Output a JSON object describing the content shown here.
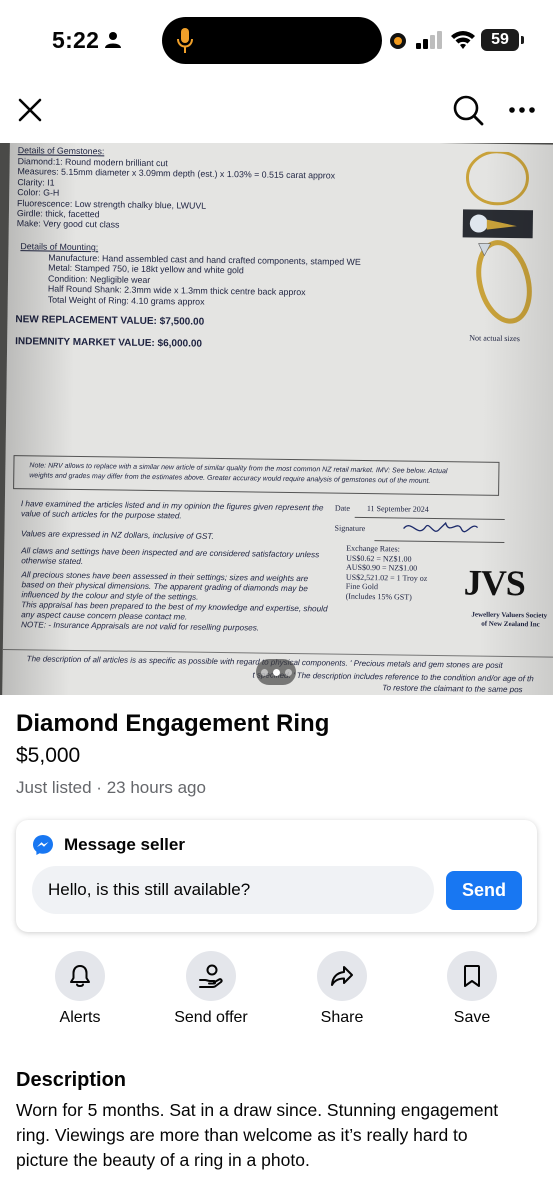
{
  "status_bar": {
    "time": "5:22",
    "battery": "59"
  },
  "photo": {
    "current_index": 2,
    "total": 3,
    "document": {
      "gem_heading": "Details of Gemstones:",
      "gem_lines": [
        "Diamond:1: Round modern brilliant cut",
        "Measures: 5.15mm diameter x 3.09mm depth (est.) x 1.03% = 0.515 carat approx",
        "Clarity: I1",
        "Color: G-H",
        "Fluorescence: Low strength chalky blue, LWUVL",
        "Girdle: thick, facetted",
        "Make: Very good cut class"
      ],
      "mount_heading": "Details of Mounting:",
      "mount_lines": [
        "Manufacture: Hand assembled cast and hand crafted components, stamped WE",
        "Metal: Stamped 750, ie 18kt yellow and white gold",
        "Condition: Negligible wear",
        "Half Round Shank: 2.3mm wide x 1.3mm thick centre back approx",
        "Total Weight of Ring: 4.10 grams approx"
      ],
      "replacement_value": "NEW REPLACEMENT VALUE: $7,500.00",
      "indemnity_value": "INDEMNITY MARKET VALUE: $6,000.00",
      "not_actual": "Not actual sizes",
      "note_lines": [
        "Note: NRV allows to replace with a similar new article of similar quality from the most common NZ retail market. IMV: See below. Actual",
        "weights and grades may differ from the estimates above. Greater accuracy would require analysis of gemstones out of the mount."
      ],
      "date_label": "Date",
      "date_value": "11 September 2024",
      "signature_label": "Signature",
      "exchange_lines": [
        "Exchange Rates:",
        "US$0.62 = NZ$1.00",
        "AUS$0.90 = NZ$1.00",
        "US$2,521.02 = 1 Troy oz",
        "Fine Gold",
        "(Includes 15% GST)"
      ],
      "left_statements": [
        "I have examined the articles listed and in my opinion the figures given represent the",
        "value of such articles for the purpose stated.",
        "Values are expressed in NZ dollars, inclusive of GST.",
        "All claws and settings have been inspected and are considered satisfactory unless",
        "otherwise stated.",
        "All precious stones have been assessed in their settings; sizes and weights are",
        "based on their physical dimensions. The apparent grading of diamonds may be",
        "influenced by the colour and style of the settings.",
        "This appraisal has been prepared to the best of my knowledge and expertise, should",
        "any aspect cause concern please contact me.",
        "NOTE: - Insurance Appraisals are not valid for reselling purposes."
      ],
      "logo_text": "JVS",
      "society_lines": [
        "Jewellery Valuers Society",
        "of New Zealand Inc"
      ],
      "footer_lines": [
        "The description of all articles is as specific as possible with regard to physical components. ' Precious metals and gem stones are posit",
        "t specified. ' The description includes reference to the condition and/or age of th",
        "To restore the claimant to the same pos"
      ]
    }
  },
  "listing": {
    "title": "Diamond Engagement Ring",
    "price": "$5,000",
    "listed": "Just listed · 23 hours ago"
  },
  "message": {
    "heading": "Message seller",
    "input_value": "Hello, is this still available?",
    "send_label": "Send"
  },
  "actions": [
    {
      "label": "Alerts",
      "icon": "bell-icon"
    },
    {
      "label": "Send offer",
      "icon": "offer-icon"
    },
    {
      "label": "Share",
      "icon": "share-icon"
    },
    {
      "label": "Save",
      "icon": "bookmark-icon"
    }
  ],
  "description": {
    "heading": "Description",
    "text": "Worn for 5 months. Sat in a draw since. Stunning engagement ring. Viewings are more than welcome as it’s really hard to picture the beauty of a ring in a photo."
  },
  "colors": {
    "accent": "#1877f2",
    "muted_text": "#65676b",
    "action_bg": "#e4e6eb"
  }
}
